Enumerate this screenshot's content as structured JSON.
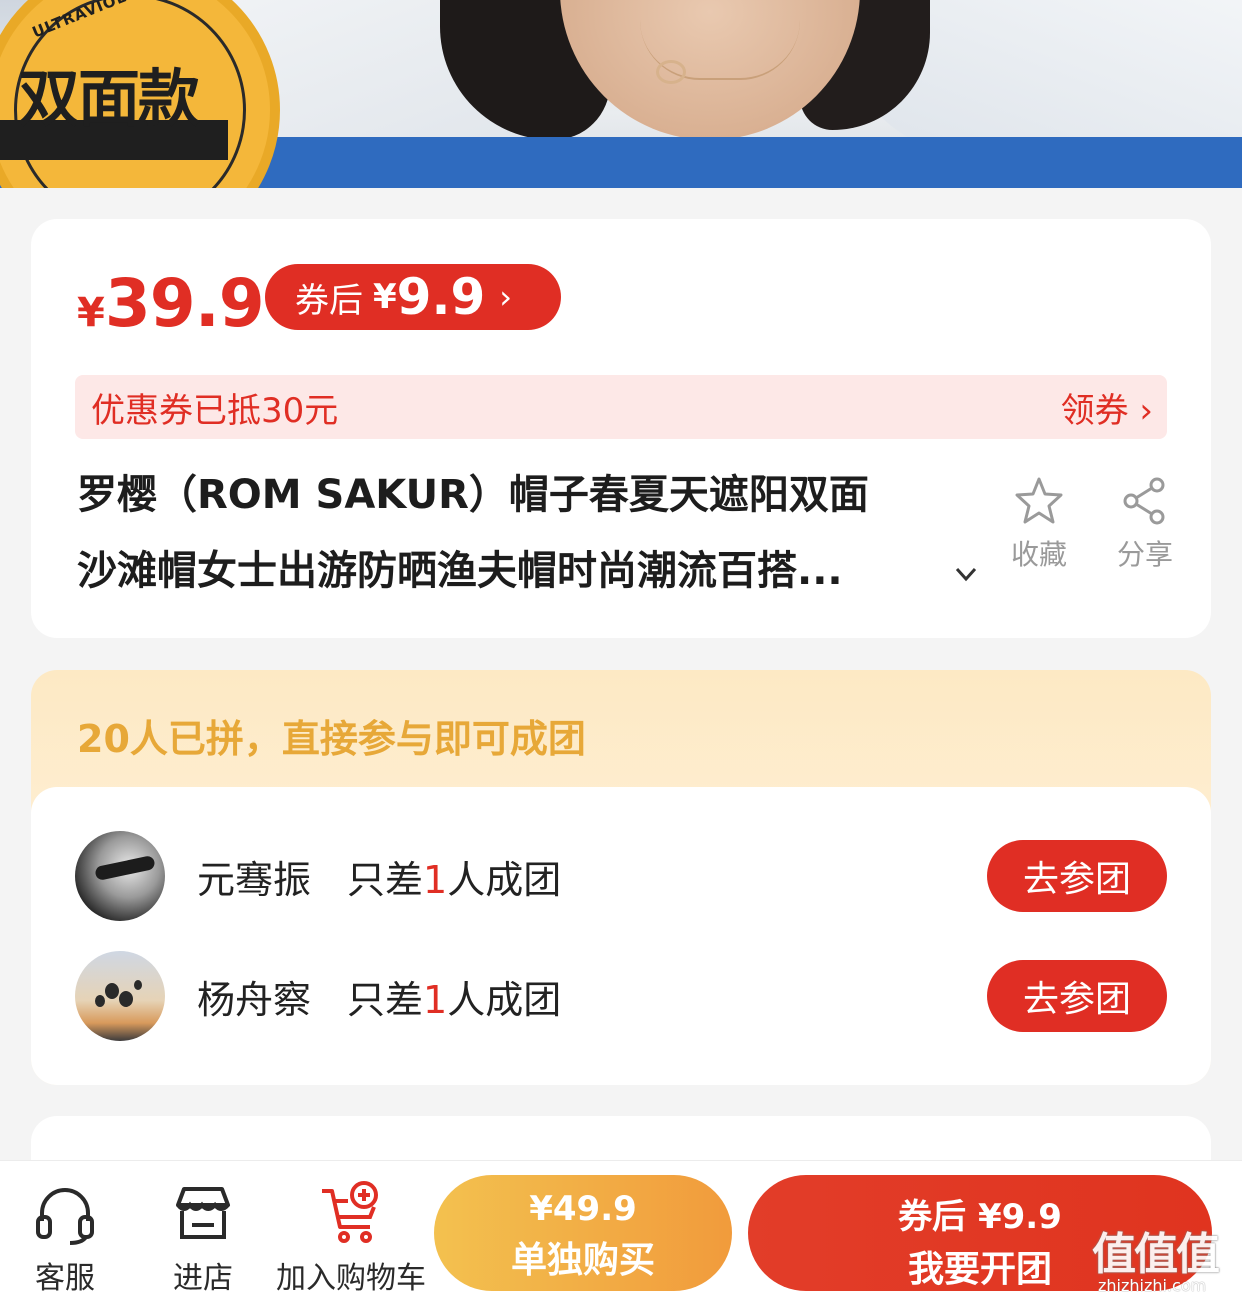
{
  "hero": {
    "badge_arc": "ULTRAVIOLET PROTECTION",
    "badge_text": "双面款"
  },
  "price": {
    "currency": "¥",
    "value": "39.9",
    "coupon_label": "券后",
    "coupon_currency": "¥",
    "coupon_value": "9.9",
    "coupon_arrow": "›"
  },
  "coupon_bar": {
    "text": "优惠券已抵30元",
    "action": "领券 ›"
  },
  "product": {
    "title_line1": "罗樱（ROM SAKUR）帽子春夏天遮阳双面",
    "title_line2": "沙滩帽女士出游防晒渔夫帽时尚潮流百搭..."
  },
  "actions": {
    "favorite": "收藏",
    "share": "分享"
  },
  "group": {
    "header": "20人已拼，直接参与即可成团",
    "rows": [
      {
        "name": "元骞振",
        "need_prefix": "只差",
        "need_count": "1",
        "need_suffix": "人成团",
        "button": "去参团"
      },
      {
        "name": "杨舟察",
        "need_prefix": "只差",
        "need_count": "1",
        "need_suffix": "人成团",
        "button": "去参团"
      }
    ]
  },
  "bottom_bar": {
    "service": "客服",
    "store": "进店",
    "cart": "加入购物车",
    "solo_price": "¥49.9",
    "solo_label": "单独购买",
    "group_price": "券后 ¥9.9",
    "group_label": "我要开团"
  },
  "watermark": {
    "text": "值值值",
    "sub": "zhizhizhi.com"
  },
  "colors": {
    "accent": "#e02e24",
    "gold": "#e7a838",
    "solo_button": "#f3c14f"
  }
}
